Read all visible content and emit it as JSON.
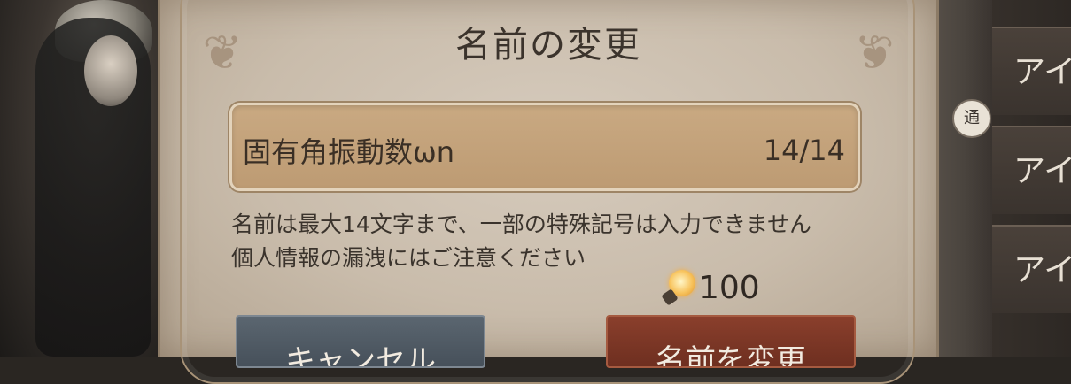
{
  "dialog": {
    "title": "名前の変更",
    "name_input": {
      "value": "固有角振動数ωn",
      "counter": "14/14"
    },
    "notes": [
      "名前は最大14文字まで、一部の特殊記号は入力できません",
      "個人情報の漏洩にはご注意ください"
    ],
    "cost": {
      "icon": "lightbulb-currency-icon",
      "value": "100"
    },
    "buttons": {
      "cancel_label": "キャンセル",
      "confirm_label": "名前を変更"
    }
  },
  "side_panel": {
    "items": [
      "アイ",
      "アイ",
      "アイ"
    ],
    "badge": "通"
  },
  "colors": {
    "dialog_bg": "#c9bcab",
    "input_bg": "#c4a27a",
    "cancel_button": "#4f5a64",
    "confirm_button": "#7a3525",
    "text": "#3b332c"
  }
}
